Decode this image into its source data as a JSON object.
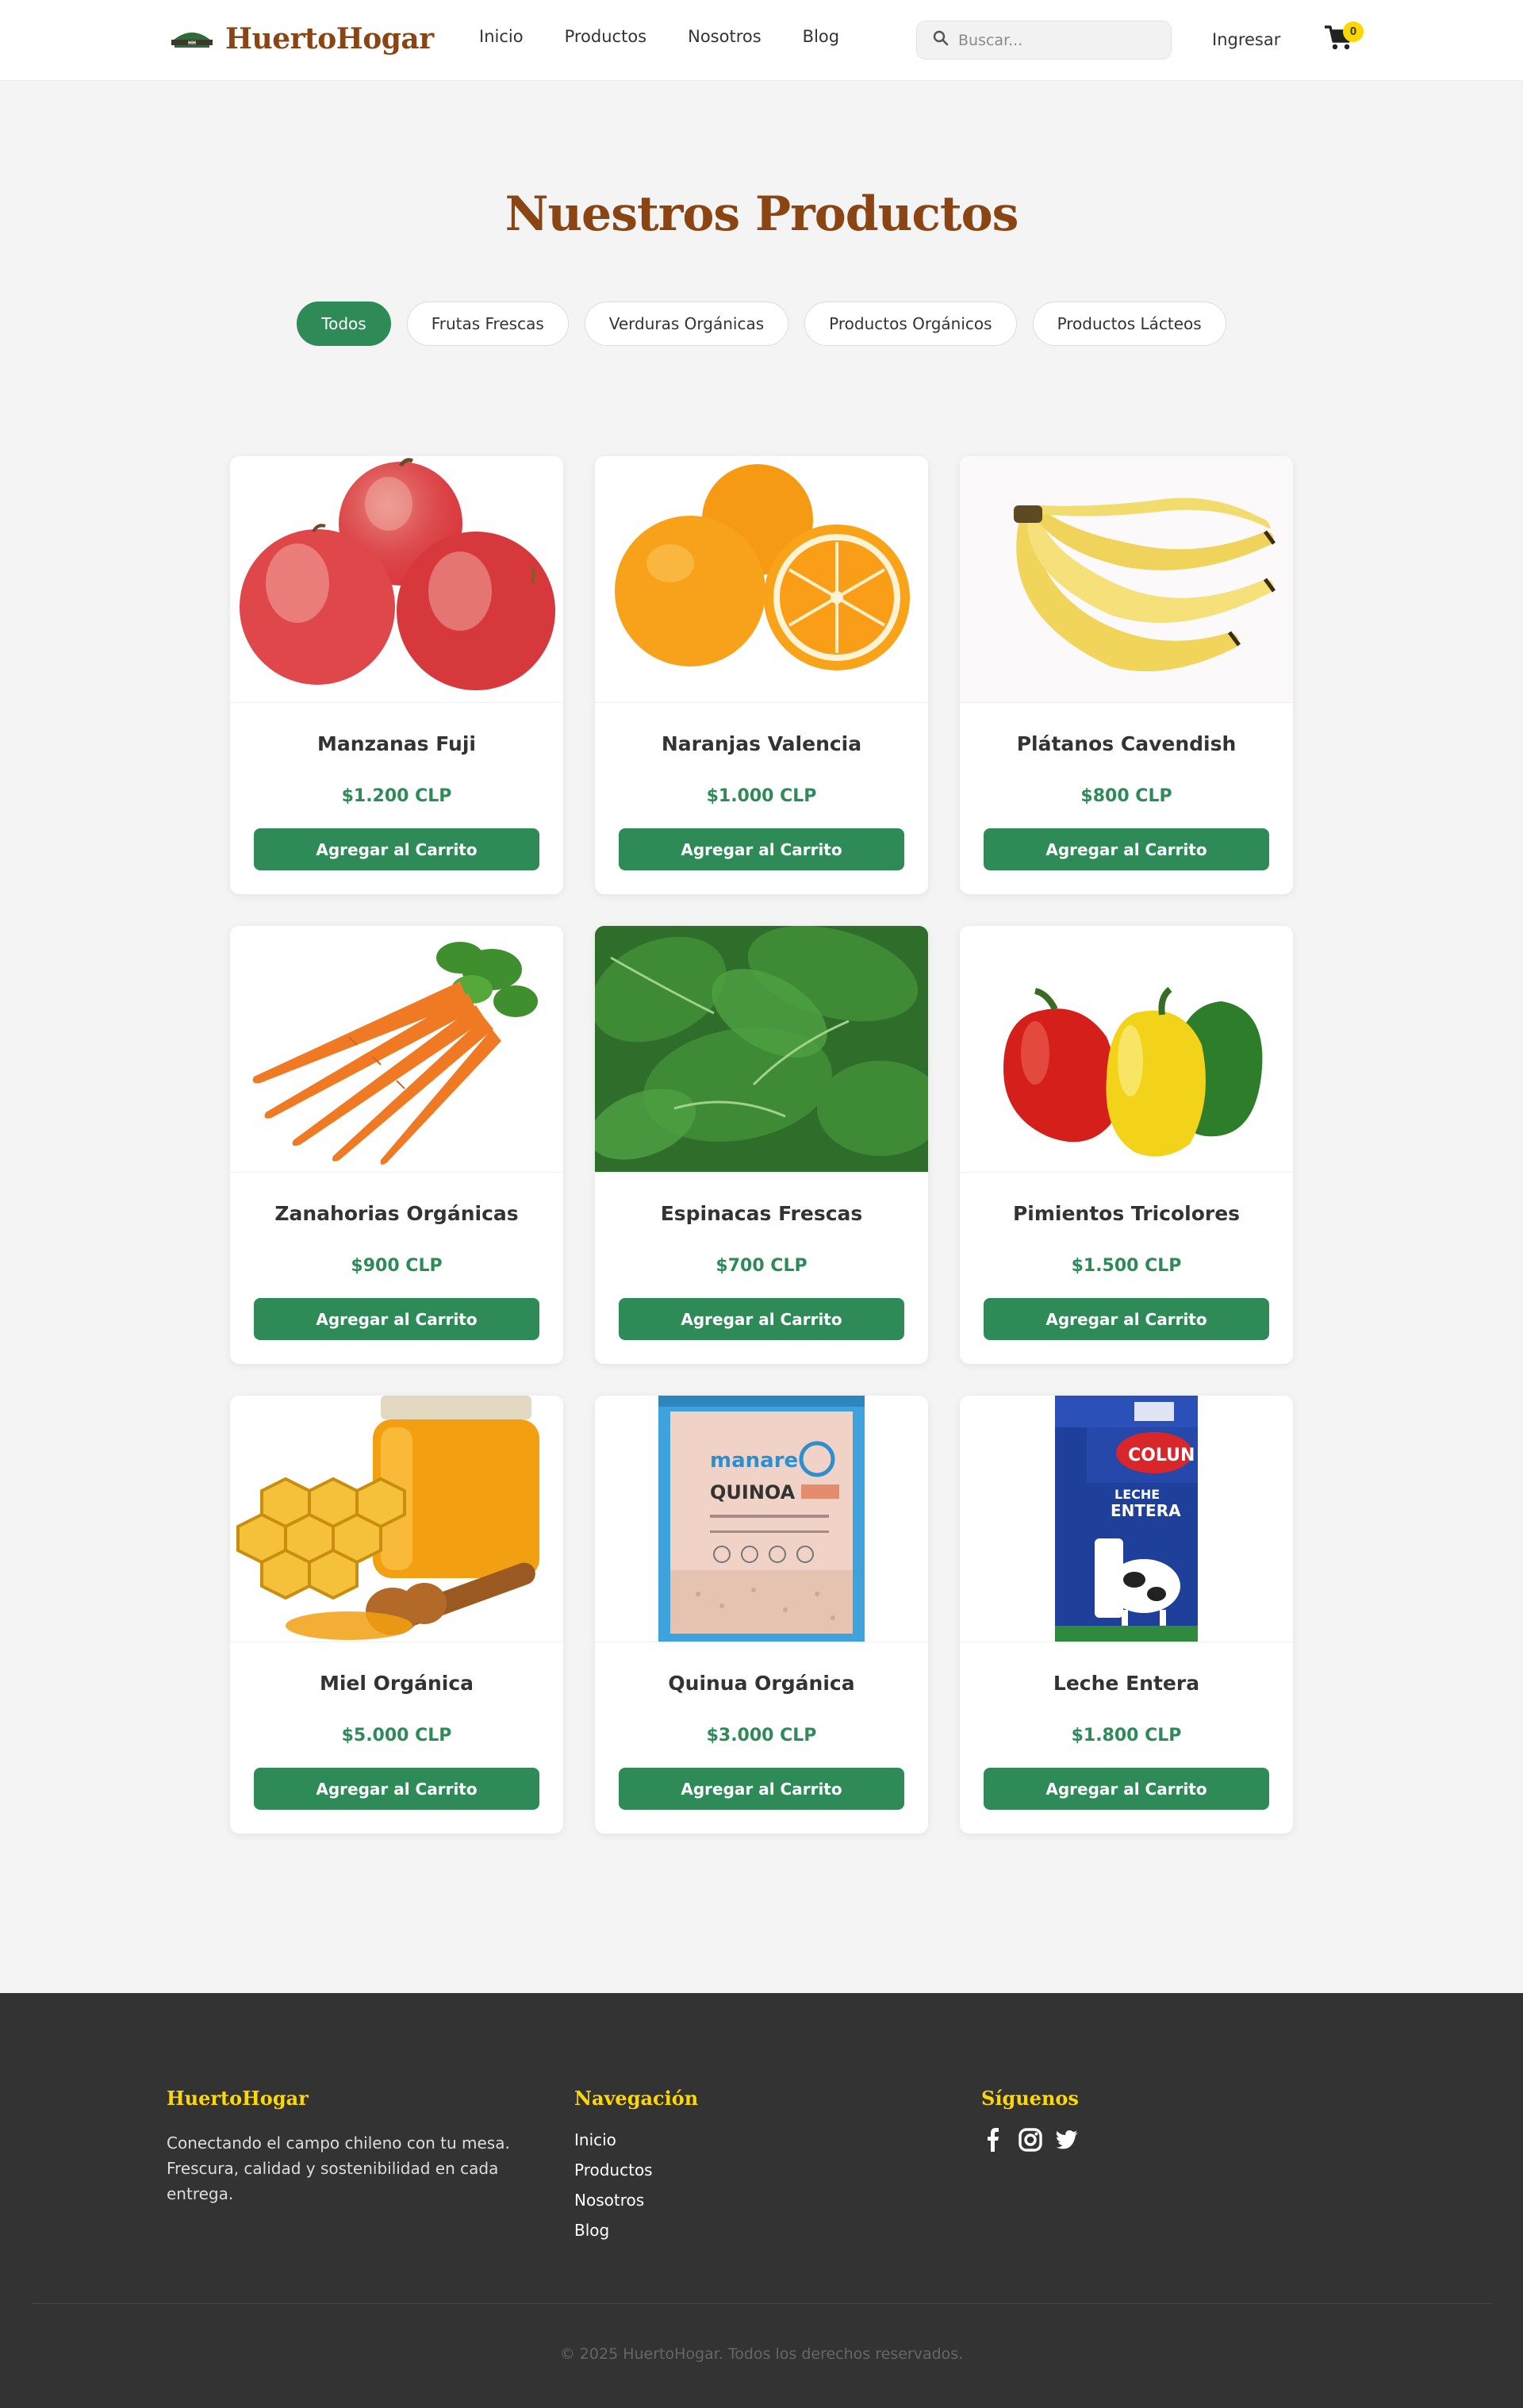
{
  "header": {
    "brand": "HuertoHogar",
    "nav": [
      "Inicio",
      "Productos",
      "Nosotros",
      "Blog"
    ],
    "search_placeholder": "Buscar...",
    "login": "Ingresar",
    "cart_count": "0"
  },
  "main": {
    "title": "Nuestros Productos",
    "filters": [
      "Todos",
      "Frutas Frescas",
      "Verduras Orgánicas",
      "Productos Orgánicos",
      "Productos Lácteos"
    ],
    "active_filter": "Todos",
    "add_label": "Agregar al Carrito",
    "products": [
      {
        "name": "Manzanas Fuji",
        "price": "$1.200 CLP",
        "icon": "apples-image"
      },
      {
        "name": "Naranjas Valencia",
        "price": "$1.000 CLP",
        "icon": "oranges-image"
      },
      {
        "name": "Plátanos Cavendish",
        "price": "$800 CLP",
        "icon": "bananas-image"
      },
      {
        "name": "Zanahorias Orgánicas",
        "price": "$900 CLP",
        "icon": "carrots-image"
      },
      {
        "name": "Espinacas Frescas",
        "price": "$700 CLP",
        "icon": "spinach-image"
      },
      {
        "name": "Pimientos Tricolores",
        "price": "$1.500 CLP",
        "icon": "peppers-image"
      },
      {
        "name": "Miel Orgánica",
        "price": "$5.000 CLP",
        "icon": "honey-image"
      },
      {
        "name": "Quinua Orgánica",
        "price": "$3.000 CLP",
        "icon": "quinoa-image"
      },
      {
        "name": "Leche Entera",
        "price": "$1.800 CLP",
        "icon": "milk-image"
      }
    ]
  },
  "footer": {
    "brand": "HuertoHogar",
    "description": "Conectando el campo chileno con tu mesa. Frescura, calidad y sostenibilidad en cada entrega.",
    "nav_title": "Navegación",
    "nav_links": [
      "Inicio",
      "Productos",
      "Nosotros",
      "Blog"
    ],
    "social_title": "Síguenos",
    "copyright": "© 2025 HuertoHogar. Todos los derechos reservados."
  },
  "colors": {
    "brand_brown": "#8b4513",
    "primary_green": "#2e8b57",
    "accent_yellow": "#ffd700",
    "footer_bg": "#333333"
  }
}
